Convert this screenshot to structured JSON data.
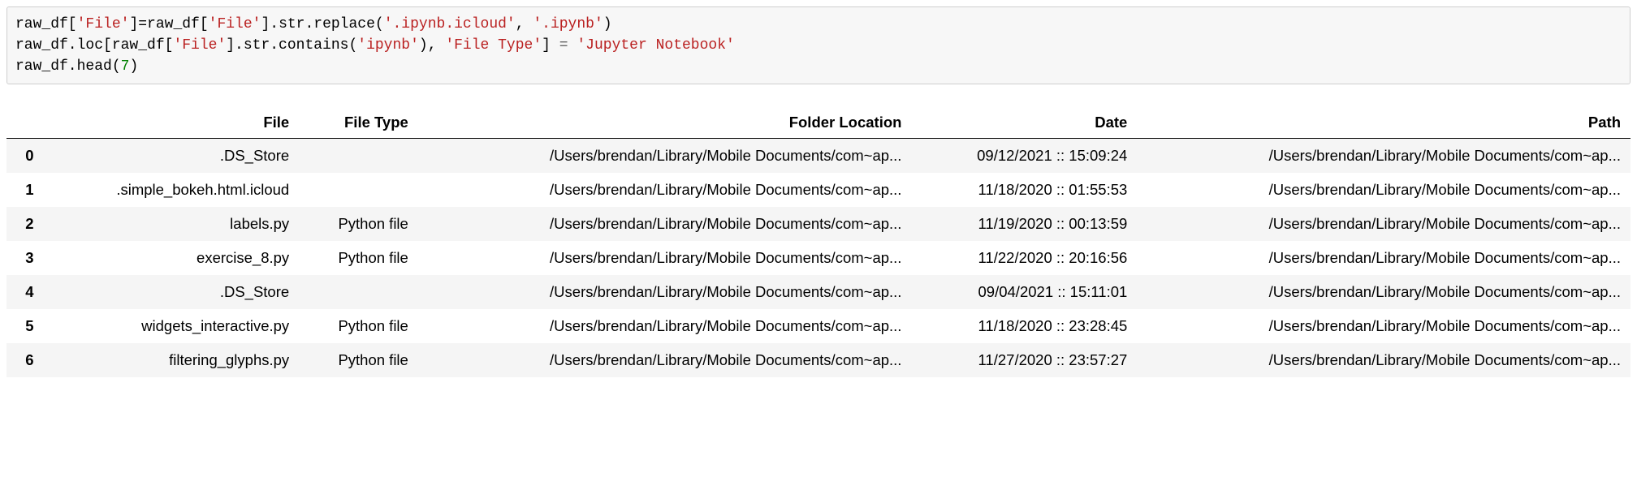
{
  "code": {
    "lines": [
      {
        "segments": [
          {
            "t": "raw_df["
          },
          {
            "t": "'File'",
            "c": "s1"
          },
          {
            "t": "]=raw_df["
          },
          {
            "t": "'File'",
            "c": "s1"
          },
          {
            "t": "].str.replace("
          },
          {
            "t": "'.ipynb.icloud'",
            "c": "s1"
          },
          {
            "t": ", "
          },
          {
            "t": "'.ipynb'",
            "c": "s1"
          },
          {
            "t": ")"
          }
        ]
      },
      {
        "segments": [
          {
            "t": "raw_df.loc[raw_df["
          },
          {
            "t": "'File'",
            "c": "s1"
          },
          {
            "t": "].str.contains("
          },
          {
            "t": "'ipynb'",
            "c": "s1"
          },
          {
            "t": "), "
          },
          {
            "t": "'File Type'",
            "c": "s1"
          },
          {
            "t": "] "
          },
          {
            "t": "=",
            "c": "op"
          },
          {
            "t": " "
          },
          {
            "t": "'Jupyter Notebook'",
            "c": "s1"
          }
        ]
      },
      {
        "segments": [
          {
            "t": "raw_df.head("
          },
          {
            "t": "7",
            "c": "s2"
          },
          {
            "t": ")"
          }
        ]
      }
    ]
  },
  "table": {
    "columns": [
      "File",
      "File Type",
      "Folder Location",
      "Date",
      "Path"
    ],
    "rows": [
      {
        "idx": "0",
        "File": ".DS_Store",
        "File Type": "",
        "Folder Location": "/Users/brendan/Library/Mobile Documents/com~ap...",
        "Date": "09/12/2021 :: 15:09:24",
        "Path": "/Users/brendan/Library/Mobile Documents/com~ap..."
      },
      {
        "idx": "1",
        "File": ".simple_bokeh.html.icloud",
        "File Type": "",
        "Folder Location": "/Users/brendan/Library/Mobile Documents/com~ap...",
        "Date": "11/18/2020 :: 01:55:53",
        "Path": "/Users/brendan/Library/Mobile Documents/com~ap..."
      },
      {
        "idx": "2",
        "File": "labels.py",
        "File Type": "Python file",
        "Folder Location": "/Users/brendan/Library/Mobile Documents/com~ap...",
        "Date": "11/19/2020 :: 00:13:59",
        "Path": "/Users/brendan/Library/Mobile Documents/com~ap..."
      },
      {
        "idx": "3",
        "File": "exercise_8.py",
        "File Type": "Python file",
        "Folder Location": "/Users/brendan/Library/Mobile Documents/com~ap...",
        "Date": "11/22/2020 :: 20:16:56",
        "Path": "/Users/brendan/Library/Mobile Documents/com~ap..."
      },
      {
        "idx": "4",
        "File": ".DS_Store",
        "File Type": "",
        "Folder Location": "/Users/brendan/Library/Mobile Documents/com~ap...",
        "Date": "09/04/2021 :: 15:11:01",
        "Path": "/Users/brendan/Library/Mobile Documents/com~ap..."
      },
      {
        "idx": "5",
        "File": "widgets_interactive.py",
        "File Type": "Python file",
        "Folder Location": "/Users/brendan/Library/Mobile Documents/com~ap...",
        "Date": "11/18/2020 :: 23:28:45",
        "Path": "/Users/brendan/Library/Mobile Documents/com~ap..."
      },
      {
        "idx": "6",
        "File": "filtering_glyphs.py",
        "File Type": "Python file",
        "Folder Location": "/Users/brendan/Library/Mobile Documents/com~ap...",
        "Date": "11/27/2020 :: 23:57:27",
        "Path": "/Users/brendan/Library/Mobile Documents/com~ap..."
      }
    ]
  }
}
